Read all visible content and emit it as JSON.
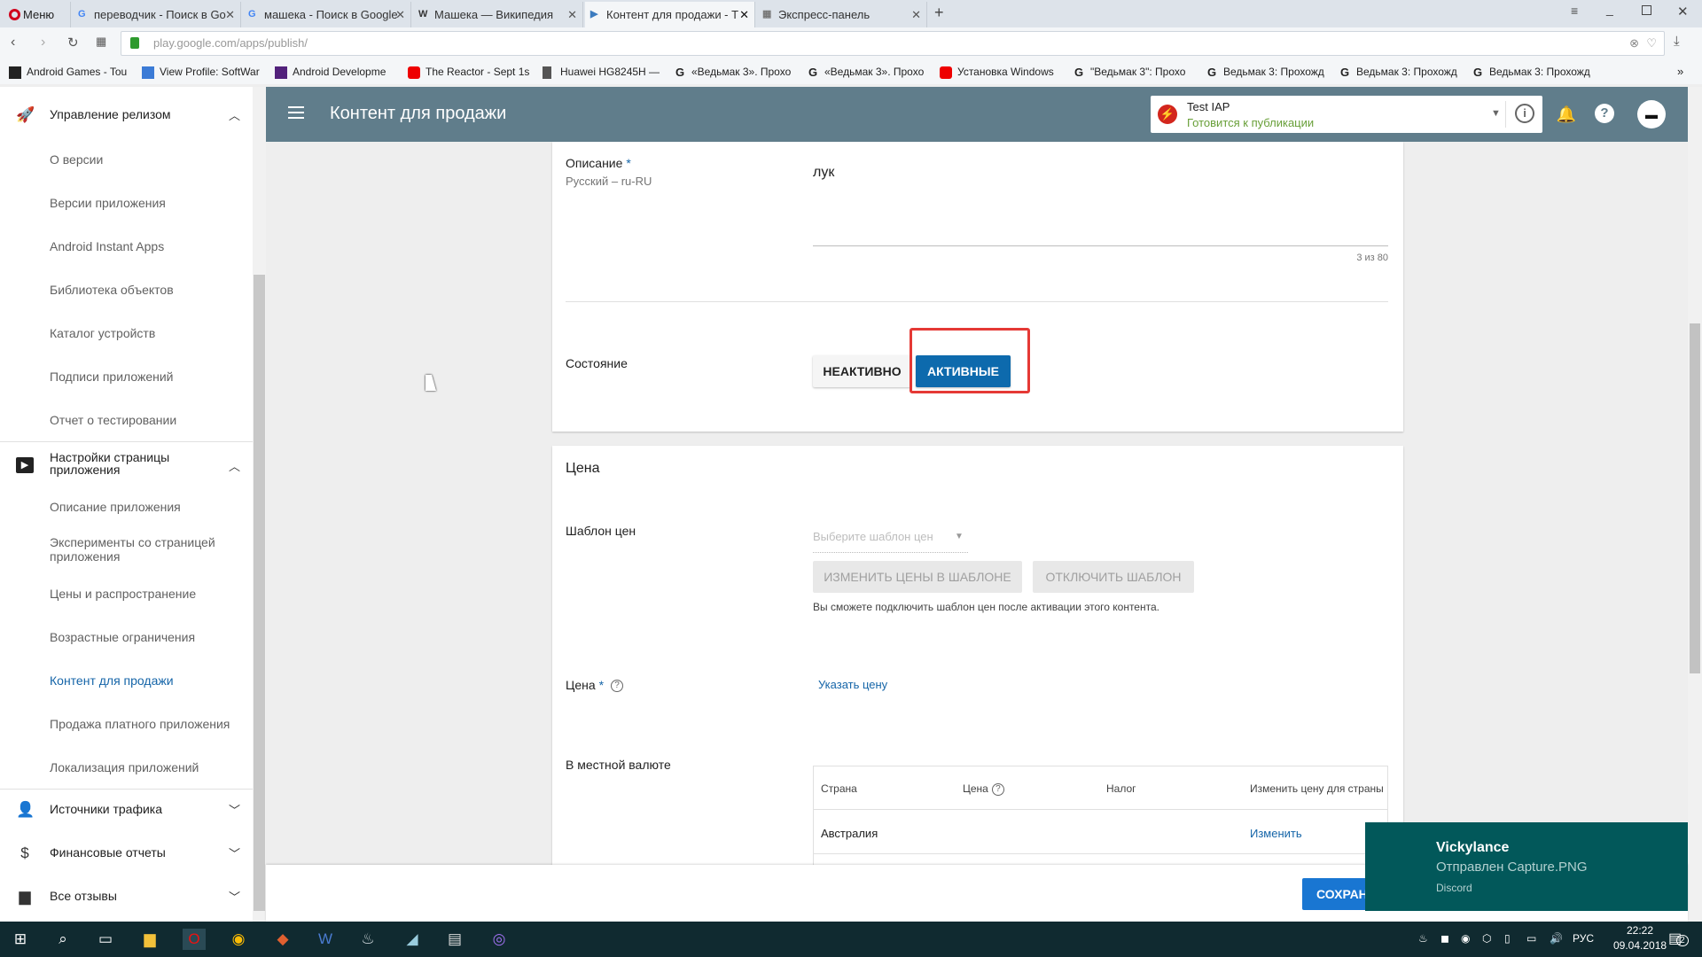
{
  "browser": {
    "menu_label": "Меню",
    "tabs": [
      {
        "title": "переводчик - Поиск в Go",
        "icon": "G"
      },
      {
        "title": "машека - Поиск в Google",
        "icon": "G"
      },
      {
        "title": "Машека — Википедия",
        "icon": "W"
      },
      {
        "title": "Контент для продажи - Т",
        "icon": "▶"
      },
      {
        "title": "Экспресс-панель",
        "icon": "▦"
      }
    ],
    "url_host": "play.google.com",
    "url_path": "/apps/publish/",
    "bookmarks": [
      "Android Games - Tou",
      "View Profile: SoftWar",
      "Android Developme",
      "The Reactor - Sept 1s",
      "Huawei HG8245H —",
      "«Ведьмак 3». Прохо",
      "«Ведьмак 3». Прохо",
      "Установка Windows",
      "\"Ведьмак 3\": Прохо",
      "Ведьмак 3: Прохожд",
      "Ведьмак 3: Прохожд",
      "Ведьмак 3: Прохожд"
    ]
  },
  "sidebar": {
    "group1": "Управление релизом",
    "group1_items": [
      "О версии",
      "Версии приложения",
      "Android Instant Apps",
      "Библиотека объектов",
      "Каталог устройств",
      "Подписи приложений",
      "Отчет о тестировании"
    ],
    "group2": "Настройки страницы приложения",
    "group2_items": [
      "Описание приложения",
      "Эксперименты со страницей приложения",
      "Цены и распространение",
      "Возрастные ограничения",
      "Контент для продажи",
      "Продажа платного приложения",
      "Локализация приложений"
    ],
    "group3": "Источники трафика",
    "group4": "Финансовые отчеты",
    "group5": "Все отзывы"
  },
  "header": {
    "title": "Контент для продажи",
    "app_name": "Test IAP",
    "app_status": "Готовится к публикации"
  },
  "description": {
    "label": "Описание",
    "required": "*",
    "language": "Русский – ru-RU",
    "value": "лук",
    "counter": "3 из 80"
  },
  "state": {
    "label": "Состояние",
    "inactive": "НЕАКТИВНО",
    "active": "АКТИВНЫЕ"
  },
  "price": {
    "heading": "Цена",
    "template_label": "Шаблон цен",
    "template_placeholder": "Выберите шаблон цен",
    "edit_template_btn": "ИЗМЕНИТЬ ЦЕНЫ В ШАБЛОНЕ",
    "disable_template_btn": "ОТКЛЮЧИТЬ ШАБЛОН",
    "hint": "Вы сможете подключить шаблон цен после активации этого контента.",
    "price_label": "Цена",
    "set_price_link": "Указать цену",
    "local_label": "В местной валюте",
    "table": {
      "headers": [
        "Страна",
        "Цена",
        "Налог",
        "Изменить цену для страны"
      ],
      "rows": [
        {
          "country": "Австралия",
          "price": "",
          "tax": "",
          "action": "Изменить"
        }
      ]
    }
  },
  "footer": {
    "save": "СОХРАНИТЬ"
  },
  "notification": {
    "title": "Vickylance",
    "message": "Отправлен Capture.PNG",
    "app": "Discord"
  },
  "taskbar": {
    "lang": "РУС",
    "time": "22:22",
    "date": "09.04.2018",
    "notif_count": "2"
  },
  "colors": {
    "header": "#607d8b",
    "accent": "#1565a8",
    "active_btn": "#0d6aad",
    "highlight": "#e53935",
    "notif": "#02585a"
  }
}
